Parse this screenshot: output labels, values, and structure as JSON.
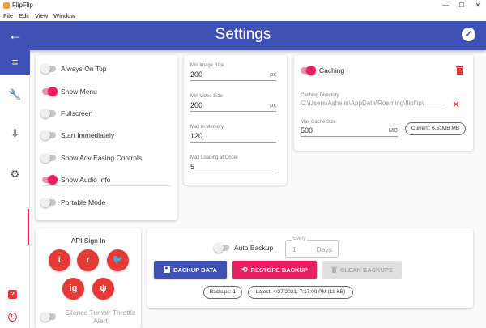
{
  "window": {
    "title": "FlipFlip",
    "controls": [
      "—",
      "☐",
      "✕"
    ]
  },
  "menu": [
    "File",
    "Edit",
    "View",
    "Window"
  ],
  "header": {
    "title": "Settings",
    "back_icon": "←",
    "save_icon": "✓"
  },
  "sidebar": {
    "menu_icon": "≡",
    "tools_icon": "🔧",
    "import_icon": "⇩",
    "settings_icon": "⚙",
    "bug_icon": "?"
  },
  "toggles": [
    {
      "label": "Always On Top",
      "on": false
    },
    {
      "label": "Show Menu",
      "on": true
    },
    {
      "label": "Fullscreen",
      "on": false
    },
    {
      "label": "Start Immediately",
      "on": false
    },
    {
      "label": "Show Adv Easing Controls",
      "on": false
    },
    {
      "label": "Show Audio Info",
      "on": true
    },
    {
      "label": "Portable Mode",
      "on": false
    }
  ],
  "sizes": [
    {
      "label": "Min Image Size",
      "value": "200",
      "unit": "px"
    },
    {
      "label": "Min Video Size",
      "value": "200",
      "unit": "px"
    },
    {
      "label": "Max in Memory",
      "value": "120",
      "unit": ""
    },
    {
      "label": "Max Loading at Once",
      "value": "5",
      "unit": ""
    }
  ],
  "caching": {
    "label": "Caching",
    "on": true,
    "dir_label": "Caching Directory",
    "dir_value": "C:\\Users\\Ashelin\\AppData\\Roaming\\flipflip\\",
    "size_label": "Max Cache Size",
    "size_value": "500",
    "size_unit": "MB",
    "current": "Current: 6.61MB MB"
  },
  "api": {
    "title": "API Sign In",
    "services": [
      "t",
      "r",
      "🐦",
      "ig",
      "ψ"
    ],
    "silence_label": "Silence Tumblr Throttle Alert",
    "silence_on": false
  },
  "backup": {
    "auto_label": "Auto Backup",
    "auto_on": false,
    "every_legend": "Every",
    "every_value": "1",
    "every_unit": "Days",
    "backup_label": "BACKUP DATA",
    "restore_label": "RESTORE BACKUP",
    "clean_label": "CLEAN BACKUPS",
    "count_text": "Backups: 1",
    "latest_text": "Latest: 4/27/2021, 7:17:00 PM (11 KB)"
  },
  "colors": {
    "primary": "#3f51b5",
    "accent": "#e91e63",
    "danger": "#e53935"
  }
}
